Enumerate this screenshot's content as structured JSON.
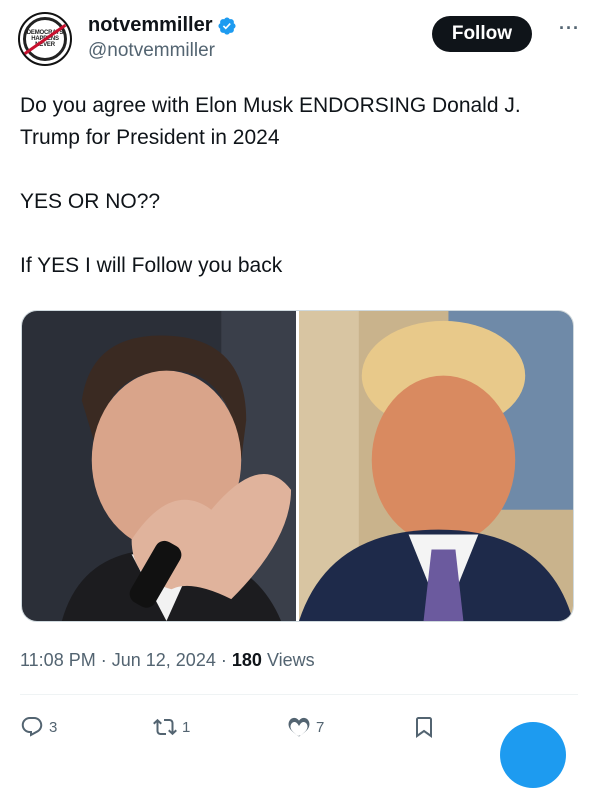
{
  "user": {
    "display_name": "notvemmiller",
    "handle": "@notvemmiller",
    "avatar_text": [
      "DEMOCRATS",
      "HAPPENS",
      "NEVER"
    ]
  },
  "follow_label": "Follow",
  "more_label": "···",
  "tweet": {
    "line1": "Do you agree with Elon Musk ENDORSING Donald J. Trump for President in 2024",
    "line2": "YES OR NO??",
    "line3": "If YES I will Follow you back"
  },
  "meta": {
    "time": "11:08 PM",
    "date": "Jun 12, 2024",
    "views_count": "180",
    "views_label": "Views",
    "dot": "·"
  },
  "actions": {
    "replies": "3",
    "reposts": "1",
    "likes": "7"
  },
  "colors": {
    "accent": "#1d9bf0",
    "text": "#0f1419",
    "muted": "#536471"
  }
}
